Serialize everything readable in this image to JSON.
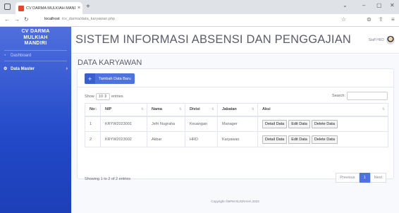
{
  "browser": {
    "tab_title": "CV DARMA MULKIAH MANDIR",
    "tab_close": "×",
    "new_tab": "+",
    "url_host": "localhost",
    "url_path": "/cv_darma/data_karyawan.php",
    "win_minimize": "–",
    "win_maximize": "▢",
    "win_close": "✕",
    "win_dropdown": "⌄",
    "back": "←",
    "forward": "→",
    "reload": "↻",
    "star": "☆",
    "extensions": "⊜",
    "share": "⇪",
    "menu": "≡"
  },
  "sidebar": {
    "brand_lines": [
      "CV DARMA",
      "MULKIAH",
      "MANDIRI"
    ],
    "items": [
      {
        "label": "Dashboard",
        "icon": "dashboard-icon",
        "glyph": "◔"
      },
      {
        "label": "Data Master",
        "icon": "gear-icon",
        "glyph": "⚙",
        "chevron": "›"
      }
    ]
  },
  "header": {
    "title": "SISTEM INFORMASI ABSENSI DAN PENGGAJIAN",
    "user_label": "Staff HRD"
  },
  "page": {
    "title": "DATA KARYAWAN",
    "add_button": "Tambah Data Baru",
    "add_glyph": "+",
    "show_label": "Show",
    "show_value": "10 ⇕",
    "entries_label": "entries",
    "search_label": "Search:",
    "columns": [
      "No",
      "NIP",
      "Nama",
      "Divisi",
      "Jabatan",
      "Aksi"
    ],
    "rows": [
      {
        "no": "1",
        "nip": "KRYW2023001",
        "nama": "Jefri Nugraha",
        "divisi": "Keuangan",
        "jabatan": "Manager"
      },
      {
        "no": "2",
        "nip": "KRYW2023002",
        "nama": "Akbar",
        "divisi": "HRD",
        "jabatan": "Karyawan"
      }
    ],
    "actions": [
      "Detail Data",
      "Edit Data",
      "Delete Data"
    ],
    "info": "Showing 1 to 2 of 2 entries",
    "pager": [
      "Previous",
      "1",
      "Next"
    ]
  },
  "footer": "Copyright ©BPM NUGRAHA 2023",
  "colors": {
    "primary": "#4e73df",
    "sidebar": "#2248c8",
    "tab_favicon": "#e8442c"
  }
}
